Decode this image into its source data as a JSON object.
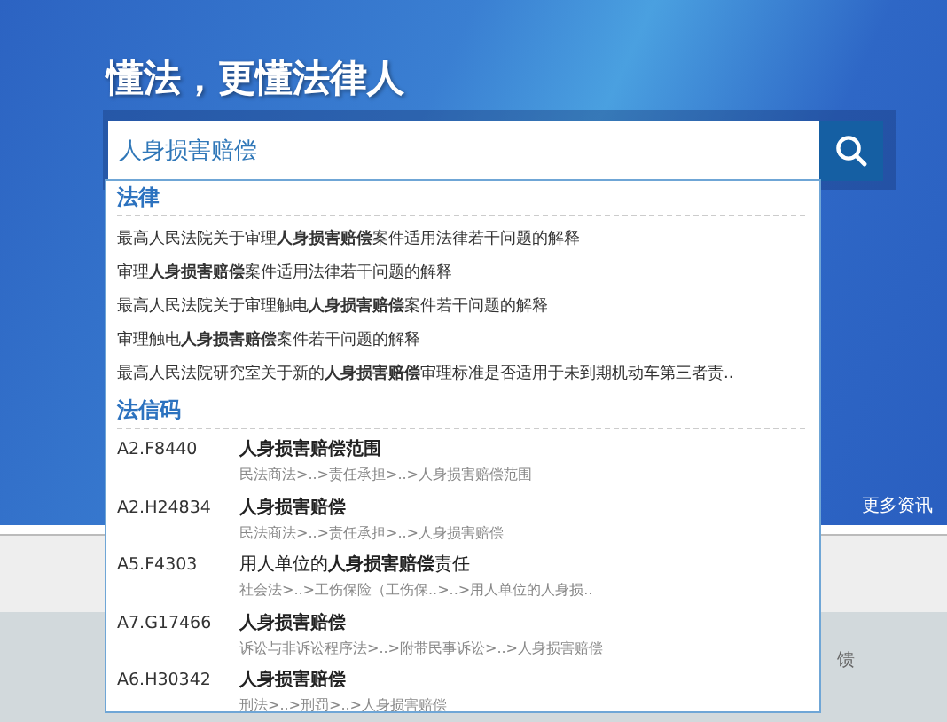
{
  "header": {
    "title": "懂法，更懂法律人",
    "more_link": "更多资讯"
  },
  "search": {
    "value": "人身损害赔偿"
  },
  "suggestions": {
    "sections": [
      {
        "kind": "law",
        "heading": "法律",
        "items": [
          {
            "text": "最高人民法院关于审理**人身损害赔偿**案件适用法律若干问题的解释"
          },
          {
            "text": "审理**人身损害赔偿**案件适用法律若干问题的解释"
          },
          {
            "text": "最高人民法院关于审理触电**人身损害赔偿**案件若干问题的解释"
          },
          {
            "text": "审理触电**人身损害赔偿**案件若干问题的解释"
          },
          {
            "text": "最高人民法院研究室关于新的**人身损害赔偿**审理标准是否适用于未到期机动车第三者责.."
          }
        ]
      },
      {
        "kind": "code",
        "heading": "法信码",
        "items": [
          {
            "code": "A2.F8440",
            "title": "**人身损害赔偿范围**",
            "path": "民法商法>..>责任承担>..>人身损害赔偿范围"
          },
          {
            "code": "A2.H24834",
            "title": "**人身损害赔偿**",
            "path": "民法商法>..>责任承担>..>人身损害赔偿"
          },
          {
            "code": "A5.F4303",
            "title": "用人单位的**人身损害赔偿**责任",
            "path": "社会法>..>工伤保险（工伤保..>..>用人单位的人身损.."
          },
          {
            "code": "A7.G17466",
            "title": "**人身损害赔偿**",
            "path": "诉讼与非诉讼程序法>..>附带民事诉讼>..>人身损害赔偿"
          },
          {
            "code": "A6.H30342",
            "title": "**人身损害赔偿**",
            "path": "刑法>..>刑罚>..>人身损害赔偿"
          }
        ]
      }
    ]
  },
  "footer": {
    "partial_text": "馈"
  }
}
